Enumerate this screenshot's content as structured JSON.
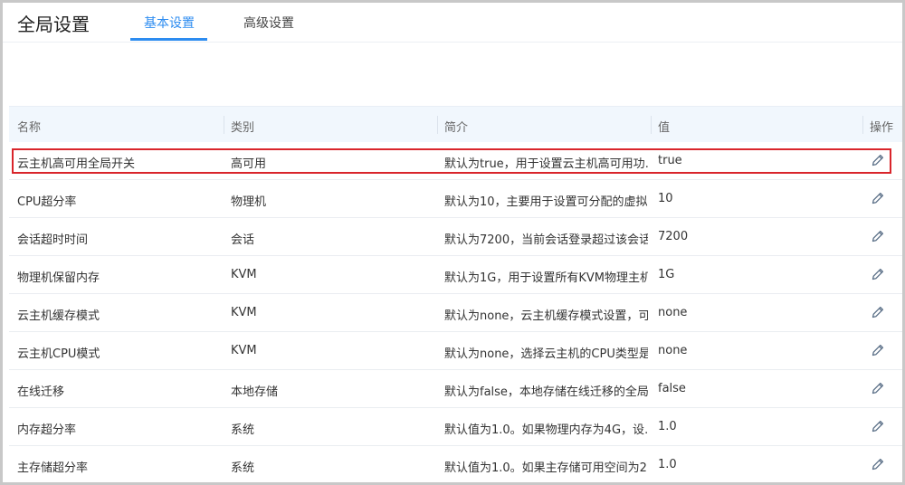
{
  "page": {
    "title": "全局设置"
  },
  "tabs": [
    {
      "label": "基本设置",
      "active": true
    },
    {
      "label": "高级设置",
      "active": false
    }
  ],
  "table": {
    "columns": [
      "名称",
      "类别",
      "简介",
      "值",
      "操作"
    ],
    "rows": [
      {
        "name": "云主机高可用全局开关",
        "category": "高可用",
        "desc": "默认为true，用于设置云主机高可用功…",
        "value": "true",
        "selected": true
      },
      {
        "name": "CPU超分率",
        "category": "物理机",
        "desc": "默认为10，主要用于设置可分配的虚拟…",
        "value": "10"
      },
      {
        "name": "会话超时时间",
        "category": "会话",
        "desc": "默认为7200，当前会话登录超过该会话…",
        "value": "7200"
      },
      {
        "name": "物理机保留内存",
        "category": "KVM",
        "desc": "默认为1G，用于设置所有KVM物理主机…",
        "value": "1G"
      },
      {
        "name": "云主机缓存模式",
        "category": "KVM",
        "desc": "默认为none，云主机缓存模式设置，可…",
        "value": "none"
      },
      {
        "name": "云主机CPU模式",
        "category": "KVM",
        "desc": "默认为none，选择云主机的CPU类型是…",
        "value": "none"
      },
      {
        "name": "在线迁移",
        "category": "本地存储",
        "desc": "默认为false，本地存储在线迁移的全局…",
        "value": "false"
      },
      {
        "name": "内存超分率",
        "category": "系统",
        "desc": "默认值为1.0。如果物理内存为4G，设…",
        "value": "1.0"
      },
      {
        "name": "主存储超分率",
        "category": "系统",
        "desc": "默认值为1.0。如果主存储可用空间为2…",
        "value": "1.0"
      }
    ]
  },
  "icons": {
    "edit": "pencil-icon"
  },
  "colors": {
    "accent": "#2d8cf0",
    "highlight": "#d9252b",
    "header_bg": "#f1f7fd"
  }
}
